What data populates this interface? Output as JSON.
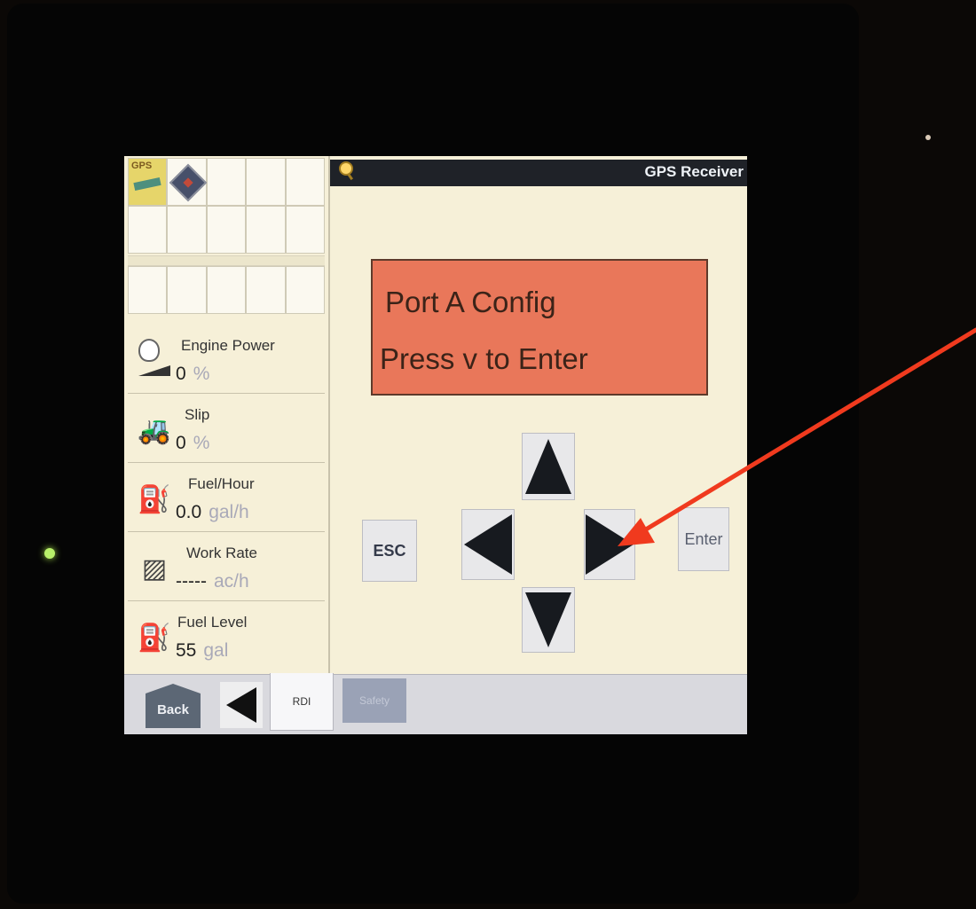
{
  "header": {
    "title": "GPS Receiver"
  },
  "left_panel": {
    "grid_top": [
      {
        "label": "GPS",
        "icon": "gps-satellite-icon"
      },
      {
        "label": "",
        "icon": "book-icon"
      }
    ],
    "gauges": [
      {
        "label": "Engine Power",
        "value": "0",
        "unit": "%",
        "icon": "engine-power-icon"
      },
      {
        "label": "Slip",
        "value": "0",
        "unit": "%",
        "icon": "tractor-slip-icon"
      },
      {
        "label": "Fuel/Hour",
        "value": "0.0",
        "unit": "gal/h",
        "icon": "fuel-rate-icon"
      },
      {
        "label": "Work Rate",
        "value": "-----",
        "unit": "ac/h",
        "icon": "work-rate-icon"
      },
      {
        "label": "Fuel Level",
        "value": "55",
        "unit": "gal",
        "icon": "fuel-pump-icon"
      }
    ]
  },
  "message": {
    "line1": "Port A Config",
    "line2": "Press v to Enter"
  },
  "keys": {
    "esc": "ESC",
    "enter": "Enter"
  },
  "bottom_bar": {
    "back": "Back",
    "tab_rdi": "RDI",
    "tab_safety": "Safety"
  },
  "colors": {
    "message_bg": "#e9775a",
    "screen_bg": "#f6f0d8",
    "annotation_arrow": "#f03a1e"
  }
}
